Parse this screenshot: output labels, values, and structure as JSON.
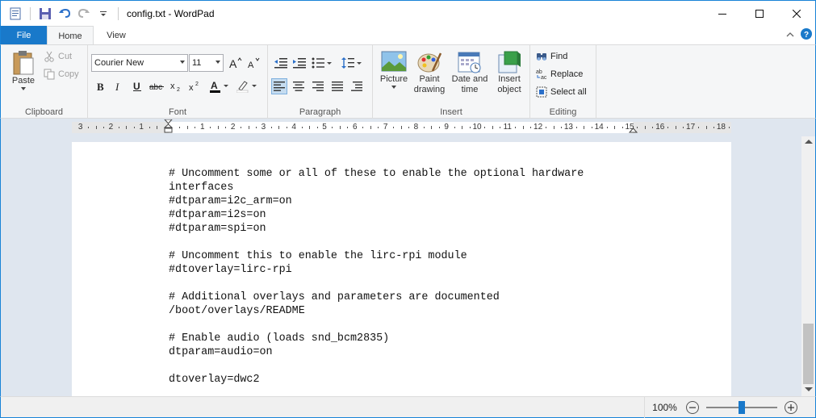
{
  "window": {
    "title": "config.txt - WordPad",
    "controls": {
      "minimize": "minimize",
      "maximize": "maximize",
      "close": "close"
    }
  },
  "tabs": {
    "file": "File",
    "home": "Home",
    "view": "View"
  },
  "clipboard": {
    "paste": "Paste",
    "cut": "Cut",
    "copy": "Copy",
    "label": "Clipboard"
  },
  "font": {
    "family": "Courier New",
    "size": "11",
    "label": "Font"
  },
  "paragraph": {
    "label": "Paragraph"
  },
  "insert": {
    "picture": "Picture",
    "paint_drawing": "Paint drawing",
    "date_time": "Date and time",
    "insert_object": "Insert object",
    "label": "Insert"
  },
  "editing": {
    "find": "Find",
    "replace": "Replace",
    "select_all": "Select all",
    "label": "Editing"
  },
  "ruler": {
    "numbers": [
      "3",
      "2",
      "1",
      "1",
      "2",
      "3",
      "4",
      "5",
      "6",
      "7",
      "8",
      "9",
      "10",
      "11",
      "12",
      "13",
      "14",
      "15",
      "16",
      "17",
      "18"
    ]
  },
  "document": {
    "lines": [
      "# Uncomment some or all of these to enable the optional hardware",
      "interfaces",
      "#dtparam=i2c_arm=on",
      "#dtparam=i2s=on",
      "#dtparam=spi=on",
      "",
      "# Uncomment this to enable the lirc-rpi module",
      "#dtoverlay=lirc-rpi",
      "",
      "# Additional overlays and parameters are documented",
      "/boot/overlays/README",
      "",
      "# Enable audio (loads snd_bcm2835)",
      "dtparam=audio=on",
      "",
      "dtoverlay=dwc2"
    ]
  },
  "status": {
    "zoom": "100%",
    "zoom_level": 0.5
  },
  "colors": {
    "accent": "#1979ca",
    "ribbon_bg": "#f5f6f7",
    "workspace_bg": "#dfe6ef"
  }
}
